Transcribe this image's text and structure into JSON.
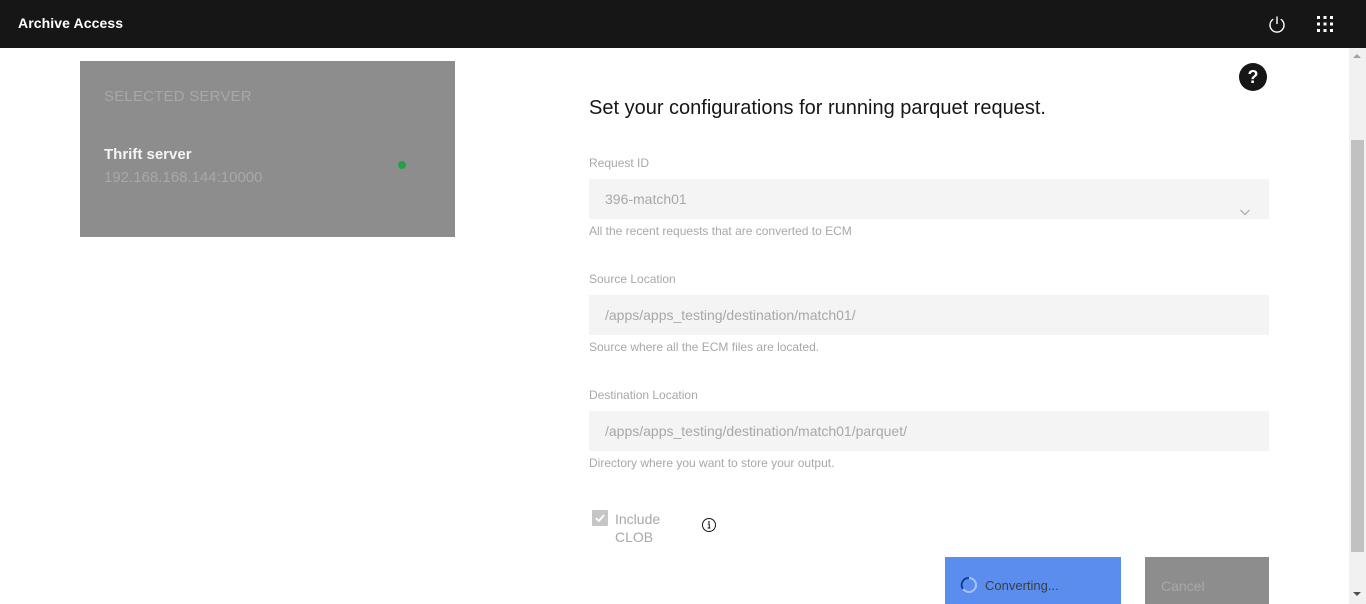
{
  "header": {
    "title": "Archive Access",
    "icons": [
      "power-icon",
      "app-switcher-icon"
    ]
  },
  "server_card": {
    "section_label": "SELECTED SERVER",
    "server_name": "Thrift server",
    "server_address": "192.168.168.144:10000",
    "status_color": "#24a148"
  },
  "help": {
    "icon": "help-icon",
    "glyph": "?"
  },
  "form": {
    "heading": "Set your configurations for running parquet request.",
    "request_id": {
      "label": "Request ID",
      "value": "396-match01",
      "helper": "All the recent requests that are converted to ECM"
    },
    "source_location": {
      "label": "Source Location",
      "value": "/apps/apps_testing/destination/match01/",
      "helper": "Source where all the ECM files are located."
    },
    "destination_location": {
      "label": "Destination Location",
      "value": "/apps/apps_testing/destination/match01/parquet/",
      "helper": "Directory where you want to store your output."
    },
    "include_clob": {
      "label": "Include CLOB",
      "checked": true
    }
  },
  "buttons": {
    "converting_label": "Converting...",
    "cancel_label": "Cancel"
  },
  "colors": {
    "header_bg": "#161616",
    "card_bg": "#8d8d8d",
    "primary": "#5b8def",
    "field_bg": "#f4f4f4",
    "muted_text": "#a8a8a8"
  }
}
